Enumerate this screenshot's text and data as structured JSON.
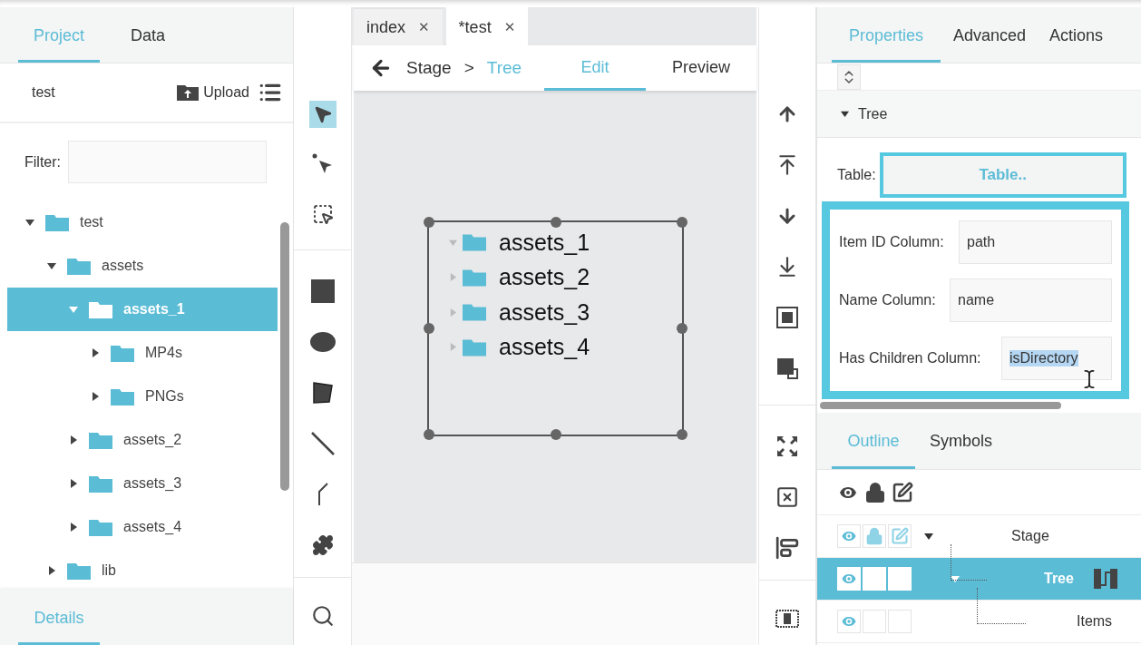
{
  "left_panel": {
    "tabs": [
      {
        "label": "Project",
        "selected": true
      },
      {
        "label": "Data",
        "selected": false
      }
    ],
    "project_name": "test",
    "upload_label": "Upload",
    "filter_label": "Filter:",
    "file_tree": [
      {
        "label": "test",
        "expanded": true,
        "selected": false,
        "children": [
          {
            "label": "assets",
            "expanded": true,
            "selected": false,
            "children": [
              {
                "label": "assets_1",
                "expanded": true,
                "selected": true,
                "children": [
                  {
                    "label": "MP4s",
                    "expanded": false,
                    "selected": false
                  },
                  {
                    "label": "PNGs",
                    "expanded": false,
                    "selected": false
                  }
                ]
              },
              {
                "label": "assets_2",
                "expanded": false,
                "selected": false
              },
              {
                "label": "assets_3",
                "expanded": false,
                "selected": false
              },
              {
                "label": "assets_4",
                "expanded": false,
                "selected": false
              }
            ]
          },
          {
            "label": "lib",
            "expanded": false,
            "selected": false
          }
        ]
      }
    ],
    "bottom_tabs": [
      {
        "label": "Details",
        "selected": true
      }
    ]
  },
  "tool_groups": [
    {
      "tools": [
        {
          "kind": "pointer",
          "selected": true
        },
        {
          "kind": "direct-select",
          "selected": false
        },
        {
          "kind": "marquee",
          "selected": false
        }
      ]
    },
    {
      "tools": [
        {
          "kind": "rectangle",
          "selected": false
        },
        {
          "kind": "ellipse",
          "selected": false
        },
        {
          "kind": "polygon",
          "selected": false
        },
        {
          "kind": "line",
          "selected": false
        },
        {
          "kind": "curve",
          "selected": false
        },
        {
          "kind": "component",
          "selected": false
        }
      ]
    },
    {
      "tools": [
        {
          "kind": "search",
          "selected": false
        }
      ]
    }
  ],
  "document_tabs": [
    {
      "label": "index",
      "close": "✕",
      "selected": false
    },
    {
      "label": "*test",
      "close": "✕",
      "selected": true
    }
  ],
  "breadcrumb": {
    "items": [
      {
        "label": "Stage",
        "current": false
      },
      {
        "label": "Tree",
        "current": true
      }
    ],
    "separator": ">"
  },
  "mode_tabs": [
    {
      "label": "Edit",
      "selected": true
    },
    {
      "label": "Preview",
      "selected": false
    }
  ],
  "canvas_tree": [
    {
      "label": "assets_1",
      "expanded": true
    },
    {
      "label": "assets_2",
      "expanded": false
    },
    {
      "label": "assets_3",
      "expanded": false
    },
    {
      "label": "assets_4",
      "expanded": false
    }
  ],
  "properties": {
    "tabs": [
      {
        "label": "Properties",
        "selected": true
      },
      {
        "label": "Advanced",
        "selected": false
      },
      {
        "label": "Actions",
        "selected": false
      }
    ],
    "section": {
      "label": "Tree",
      "expanded": true
    },
    "table": {
      "label": "Table:",
      "button": "Table..",
      "highlighted": true
    },
    "column_group": {
      "highlighted": true,
      "fields": [
        {
          "label": "Item ID Column:",
          "value": "path",
          "text_selected": false
        },
        {
          "label": "Name Column:",
          "value": "name",
          "text_selected": false
        },
        {
          "label": "Has Children Column:",
          "value": "isDirectory",
          "text_selected": true
        }
      ]
    }
  },
  "outline": {
    "tabs": [
      {
        "label": "Outline",
        "selected": true
      },
      {
        "label": "Symbols",
        "selected": false
      }
    ],
    "rows": [
      {
        "label": "Stage",
        "visible": true,
        "locked": true,
        "editable": true,
        "expanded": true,
        "selected": false,
        "children": [
          {
            "label": "Tree",
            "kind": "tree",
            "visible": true,
            "locked": false,
            "editable": false,
            "expanded": true,
            "selected": true,
            "children": [
              {
                "label": "Items",
                "visible": true,
                "locked": false,
                "editable": false,
                "selected": false
              }
            ]
          }
        ]
      }
    ]
  }
}
